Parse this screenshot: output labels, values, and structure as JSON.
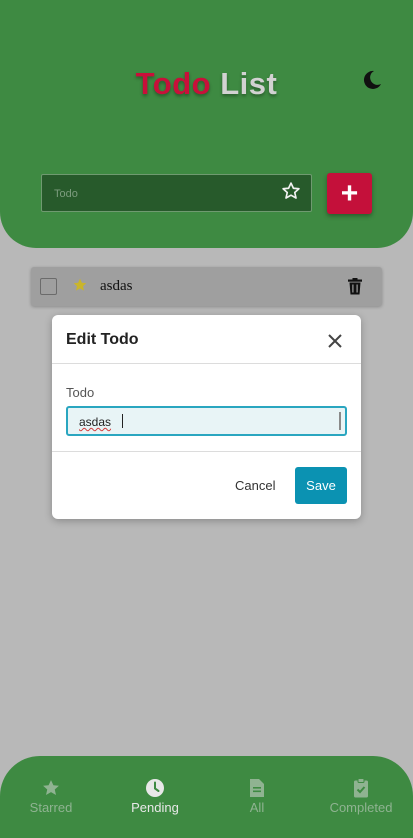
{
  "header": {
    "title_word1": "Todo",
    "title_word2": "List",
    "theme_icon": "moon-icon"
  },
  "new_todo": {
    "placeholder": "Todo",
    "star_icon": "star-outline-icon",
    "add_label": "+"
  },
  "todos": [
    {
      "text": "asdas",
      "starred": true,
      "completed": false
    }
  ],
  "edit_modal": {
    "title": "Edit Todo",
    "field_label": "Todo",
    "field_value": "asdas",
    "cancel_label": "Cancel",
    "save_label": "Save"
  },
  "bottom_nav": {
    "items": [
      {
        "label": "Starred",
        "icon": "star-icon",
        "active": false
      },
      {
        "label": "Pending",
        "icon": "clock-icon",
        "active": true
      },
      {
        "label": "All",
        "icon": "document-icon",
        "active": false
      },
      {
        "label": "Completed",
        "icon": "clipboard-check-icon",
        "active": false
      }
    ]
  },
  "colors": {
    "header_green": "#3e8a42",
    "title_red": "#c8103a",
    "add_button": "#c4103a",
    "save_button": "#0b92b2",
    "starred_yellow": "#c9b52c"
  }
}
